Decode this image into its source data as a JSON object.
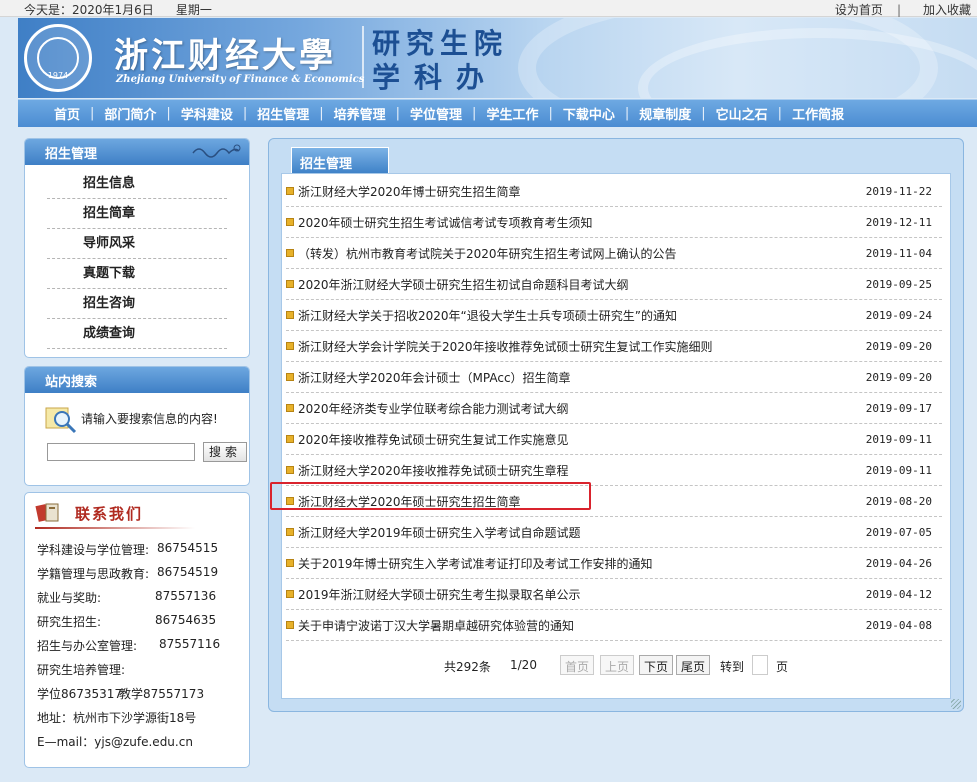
{
  "topbar": {
    "date": "今天是：2020年1月6日",
    "weekday": "星期一",
    "set_home": "设为首页",
    "separator": "|",
    "add_fav": "加入收藏"
  },
  "banner": {
    "uni_name_cn": "浙江财经大學",
    "uni_name_en": "Zhejiang University of Finance & Economics",
    "seal_year": "1974",
    "dept_line1": "研究生院",
    "dept_line2": "学科办"
  },
  "nav": {
    "items": [
      "首页",
      "部门简介",
      "学科建设",
      "招生管理",
      "培养管理",
      "学位管理",
      "学生工作",
      "下载中心",
      "规章制度",
      "它山之石",
      "工作简报"
    ],
    "separator": "|"
  },
  "sidebar": {
    "title": "招生管理",
    "items": [
      "招生信息",
      "招生简章",
      "导师风采",
      "真题下载",
      "招生咨询",
      "成绩查询"
    ]
  },
  "search": {
    "title": "站内搜索",
    "prompt": "请输入要搜索信息的内容!",
    "value": "",
    "button": "搜索"
  },
  "contact": {
    "title": "联系我们",
    "rows": [
      {
        "label": "学科建设与学位管理:",
        "value": "86754515"
      },
      {
        "label": "学籍管理与思政教育:",
        "value": "86754519"
      },
      {
        "label": "就业与奖助:",
        "value": "87557136"
      },
      {
        "label": "研究生招生:",
        "value": "86754635"
      },
      {
        "label": "招生与办公室管理:",
        "value": "87557116"
      },
      {
        "label": "研究生培养管理:",
        "value": ""
      },
      {
        "label": "学位86735317",
        "value": "教学87557173"
      },
      {
        "label": "地址：杭州市下沙学源街18号",
        "value": ""
      },
      {
        "label": "E—mail：yjs@zufe.edu.cn",
        "value": ""
      }
    ]
  },
  "main": {
    "tab": "招生管理",
    "news": [
      {
        "title": "浙江财经大学2020年博士研究生招生简章",
        "date": "2019-11-22"
      },
      {
        "title": "2020年硕士研究生招生考试诚信考试专项教育考生须知",
        "date": "2019-12-11"
      },
      {
        "title": "（转发）杭州市教育考试院关于2020年研究生招生考试网上确认的公告",
        "date": "2019-11-04"
      },
      {
        "title": "2020年浙江财经大学硕士研究生招生初试自命题科目考试大纲",
        "date": "2019-09-25"
      },
      {
        "title": "浙江财经大学关于招收2020年“退役大学生士兵专项硕士研究生”的通知",
        "date": "2019-09-24"
      },
      {
        "title": "浙江财经大学会计学院关于2020年接收推荐免试硕士研究生复试工作实施细则",
        "date": "2019-09-20"
      },
      {
        "title": "浙江财经大学2020年会计硕士（MPAcc）招生简章",
        "date": "2019-09-20"
      },
      {
        "title": "2020年经济类专业学位联考综合能力测试考试大纲",
        "date": "2019-09-17"
      },
      {
        "title": "2020年接收推荐免试硕士研究生复试工作实施意见",
        "date": "2019-09-11"
      },
      {
        "title": "浙江财经大学2020年接收推荐免试硕士研究生章程",
        "date": "2019-09-11"
      },
      {
        "title": "浙江财经大学2020年硕士研究生招生简章",
        "date": "2019-08-20"
      },
      {
        "title": "浙江财经大学2019年硕士研究生入学考试自命题试题",
        "date": "2019-07-05"
      },
      {
        "title": "关于2019年博士研究生入学考试准考证打印及考试工作安排的通知",
        "date": "2019-04-26"
      },
      {
        "title": "2019年浙江财经大学硕士研究生考生拟录取名单公示",
        "date": "2019-04-12"
      },
      {
        "title": "关于申请宁波诺丁汉大学暑期卓越研究体验营的通知",
        "date": "2019-04-08"
      }
    ],
    "pager": {
      "total": "共292条",
      "page": "1/20",
      "first": "首页",
      "prev": "上页",
      "next": "下页",
      "last": "尾页",
      "goto": "转到",
      "page_unit": "页"
    }
  },
  "colors": {
    "accent_blue": "#4b8cd2",
    "highlight_red": "#d9232d",
    "contact_red": "#b02a20",
    "bullet": "#e7b12a"
  }
}
